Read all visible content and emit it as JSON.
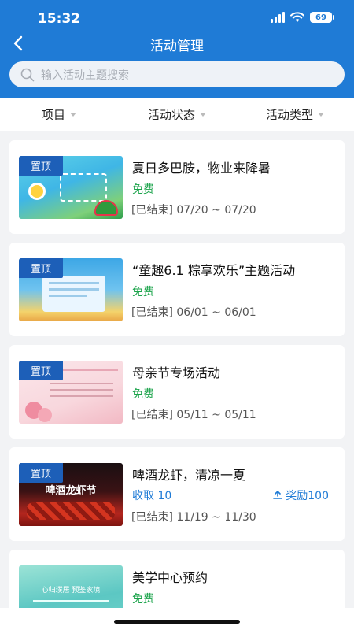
{
  "status_bar": {
    "time": "15:32",
    "battery": "69"
  },
  "nav": {
    "title": "活动管理"
  },
  "search": {
    "placeholder": "输入活动主题搜索"
  },
  "filters": [
    {
      "label": "项目"
    },
    {
      "label": "活动状态"
    },
    {
      "label": "活动类型"
    }
  ],
  "cards": [
    {
      "pin": "置顶",
      "title": "夏日多巴胺，物业来降暑",
      "fee": "免费",
      "status": "[已结束] 07/20 ~ 07/20"
    },
    {
      "pin": "置顶",
      "title": "“童趣6.1 粽享欢乐”主题活动",
      "fee": "免费",
      "status": "[已结束] 06/01 ~ 06/01"
    },
    {
      "pin": "置顶",
      "title": "母亲节专场活动",
      "fee": "免费",
      "status": "[已结束] 05/11 ~ 05/11"
    },
    {
      "pin": "置顶",
      "title": "啤酒龙虾，清凉一夏",
      "collect": "收取 10",
      "reward": "奖励100",
      "status": "[已结束] 11/19 ~ 11/30",
      "thumb_caption": "啤酒龙虾节"
    },
    {
      "title": "美学中心预约",
      "fee": "免费",
      "thumb_caption": "心归璞居 预鉴家境"
    }
  ],
  "colors": {
    "primary": "#1f7bd6",
    "free_green": "#1aa34a",
    "pin_blue": "#1d5fb8"
  }
}
